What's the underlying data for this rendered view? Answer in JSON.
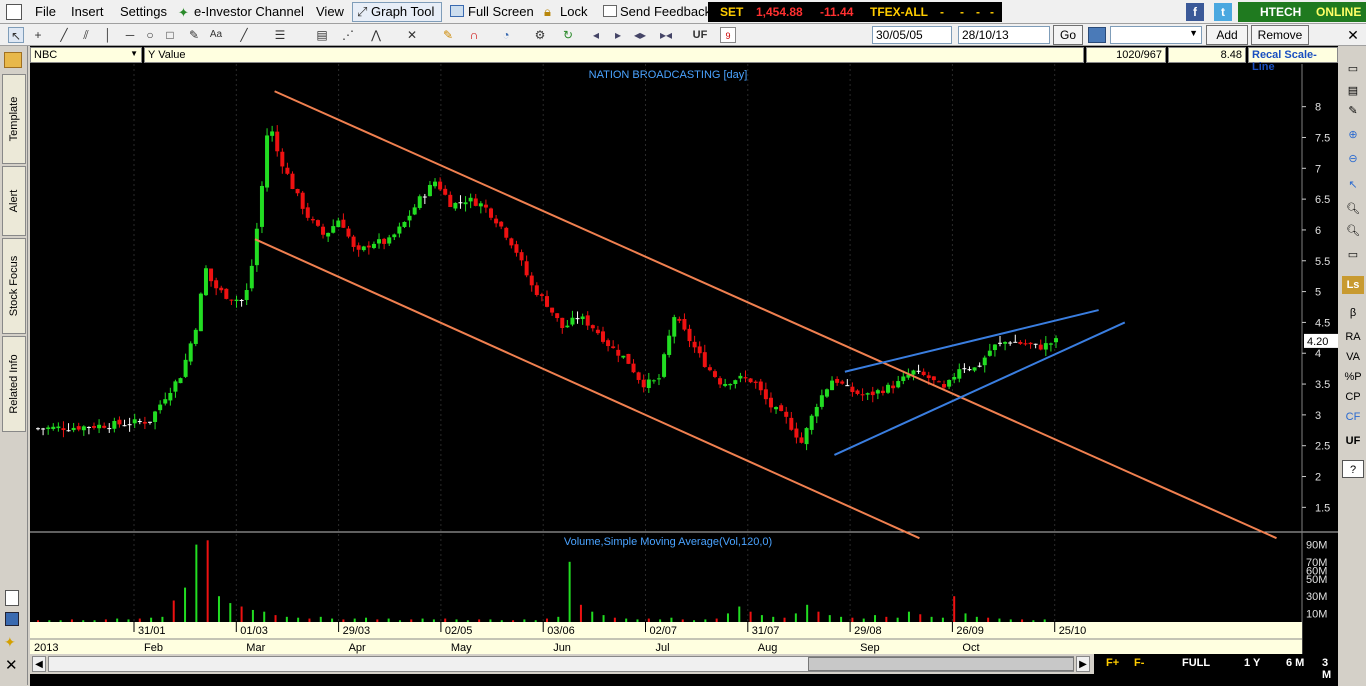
{
  "menu": {
    "file": "File",
    "insert": "Insert",
    "settings": "Settings",
    "investor_channel": "e-Investor Channel",
    "view": "View",
    "graph_tool": "Graph Tool",
    "full_screen": "Full Screen",
    "lock": "Lock",
    "send_feedback": "Send Feedback"
  },
  "ticker": {
    "index": "SET",
    "value": "1,454.88",
    "change": "-11.44",
    "tfex": "TFEX-ALL",
    "dash1": "-",
    "dash2": "-",
    "dash3": "-",
    "dash4": "-"
  },
  "account": {
    "broker": "HTECH",
    "status": "ONLINE"
  },
  "toolbar": {
    "uf": "UF",
    "date_from": "30/05/05",
    "date_to": "28/10/13",
    "go": "Go",
    "add": "Add",
    "remove": "Remove",
    "calendar_num": "9"
  },
  "symbol": {
    "name": "NBC",
    "field": "Y Value",
    "bars": "1020/967",
    "value": "8.48",
    "recal": "Recal Scale-Line"
  },
  "left_tabs": [
    "Template",
    "Alert",
    "Stock Focus",
    "Related Info"
  ],
  "right_tools": [
    "RA",
    "VA",
    "%P",
    "CP",
    "CF",
    "UF"
  ],
  "chart_data": {
    "type": "candlestick",
    "title": "NATION BROADCASTING [day]",
    "volume_title": "Volume,Simple Moving Average(Vol,120,0)",
    "ylim": [
      1.1,
      8.4
    ],
    "y_ticks": [
      "8",
      "7.5",
      "7",
      "6.5",
      "6",
      "5.5",
      "5",
      "4.5",
      "4",
      "3.5",
      "3",
      "2.5",
      "2",
      "1.5"
    ],
    "current_price": "4.20",
    "volume_ticks": [
      "90M",
      "70M",
      "60M",
      "50M",
      "30M",
      "10M"
    ],
    "date_ticks": [
      "31/01",
      "01/03",
      "29/03",
      "02/05",
      "03/06",
      "02/07",
      "31/07",
      "29/08",
      "26/09",
      "25/10"
    ],
    "month_labels": [
      "2013",
      "Feb",
      "Mar",
      "Apr",
      "May",
      "Jun",
      "Jul",
      "Aug",
      "Sep",
      "Oct"
    ],
    "price_path": [
      [
        0,
        2.78
      ],
      [
        5,
        2.8
      ],
      [
        10,
        2.85
      ],
      [
        14,
        2.9
      ],
      [
        16,
        3.3
      ],
      [
        18,
        3.65
      ],
      [
        20,
        4.5
      ],
      [
        21,
        5.4
      ],
      [
        22,
        5.1
      ],
      [
        24,
        4.9
      ],
      [
        26,
        4.85
      ],
      [
        27,
        5.5
      ],
      [
        28,
        6.5
      ],
      [
        29,
        7.8
      ],
      [
        30,
        7.3
      ],
      [
        32,
        6.7
      ],
      [
        34,
        6.2
      ],
      [
        36,
        5.9
      ],
      [
        38,
        6.2
      ],
      [
        40,
        5.6
      ],
      [
        42,
        5.8
      ],
      [
        44,
        5.8
      ],
      [
        46,
        6.1
      ],
      [
        48,
        6.5
      ],
      [
        50,
        6.8
      ],
      [
        52,
        6.4
      ],
      [
        54,
        6.5
      ],
      [
        56,
        6.4
      ],
      [
        58,
        6.1
      ],
      [
        60,
        5.7
      ],
      [
        62,
        5.1
      ],
      [
        64,
        4.8
      ],
      [
        66,
        4.4
      ],
      [
        68,
        4.6
      ],
      [
        70,
        4.4
      ],
      [
        72,
        4.1
      ],
      [
        74,
        3.9
      ],
      [
        76,
        3.5
      ],
      [
        78,
        3.55
      ],
      [
        80,
        4.6
      ],
      [
        82,
        4.2
      ],
      [
        84,
        3.8
      ],
      [
        86,
        3.5
      ],
      [
        88,
        3.6
      ],
      [
        90,
        3.55
      ],
      [
        92,
        3.15
      ],
      [
        94,
        2.95
      ],
      [
        96,
        2.55
      ],
      [
        98,
        3.2
      ],
      [
        100,
        3.6
      ],
      [
        102,
        3.4
      ],
      [
        104,
        3.3
      ],
      [
        106,
        3.4
      ],
      [
        108,
        3.5
      ],
      [
        110,
        3.7
      ],
      [
        112,
        3.6
      ],
      [
        114,
        3.4
      ],
      [
        116,
        3.8
      ],
      [
        118,
        3.75
      ],
      [
        120,
        4.1
      ],
      [
        122,
        4.2
      ],
      [
        124,
        4.15
      ],
      [
        126,
        4.1
      ],
      [
        128,
        4.2
      ]
    ],
    "volume_path": [
      2,
      2,
      2,
      3,
      2,
      2,
      3,
      4,
      3,
      4,
      5,
      6,
      25,
      40,
      90,
      95,
      30,
      22,
      18,
      14,
      12,
      8,
      6,
      5,
      4,
      6,
      4,
      3,
      4,
      5,
      3,
      4,
      2,
      3,
      4,
      3,
      4,
      3,
      2,
      3,
      3,
      2,
      2,
      3,
      2,
      4,
      6,
      70,
      20,
      12,
      8,
      5,
      4,
      3,
      4,
      3,
      5,
      3,
      2,
      3,
      4,
      10,
      18,
      12,
      8,
      6,
      5,
      10,
      20,
      12,
      8,
      6,
      5,
      4,
      8,
      6,
      5,
      12,
      9,
      6,
      5,
      30,
      10,
      6,
      5,
      4,
      3,
      3,
      2,
      3
    ],
    "trendlines": [
      {
        "color": "#f08050",
        "from": [
          0.187,
          8.25
        ],
        "to": [
          0.953,
          1.0
        ],
        "label": ""
      },
      {
        "color": "#f08050",
        "from": [
          0.172,
          5.85
        ],
        "to": [
          0.68,
          1.0
        ],
        "label": ""
      },
      {
        "color": "#3a7ee0",
        "from": [
          0.615,
          2.35
        ],
        "to": [
          0.837,
          4.5
        ],
        "label": ""
      },
      {
        "color": "#3a7ee0",
        "from": [
          0.623,
          3.7
        ],
        "to": [
          0.817,
          4.7
        ],
        "label": ""
      }
    ]
  },
  "bottom": {
    "f_plus": "F+",
    "f_minus": "F-",
    "full": "FULL",
    "y1": "1 Y",
    "m6": "6 M",
    "m3": "3 M"
  }
}
